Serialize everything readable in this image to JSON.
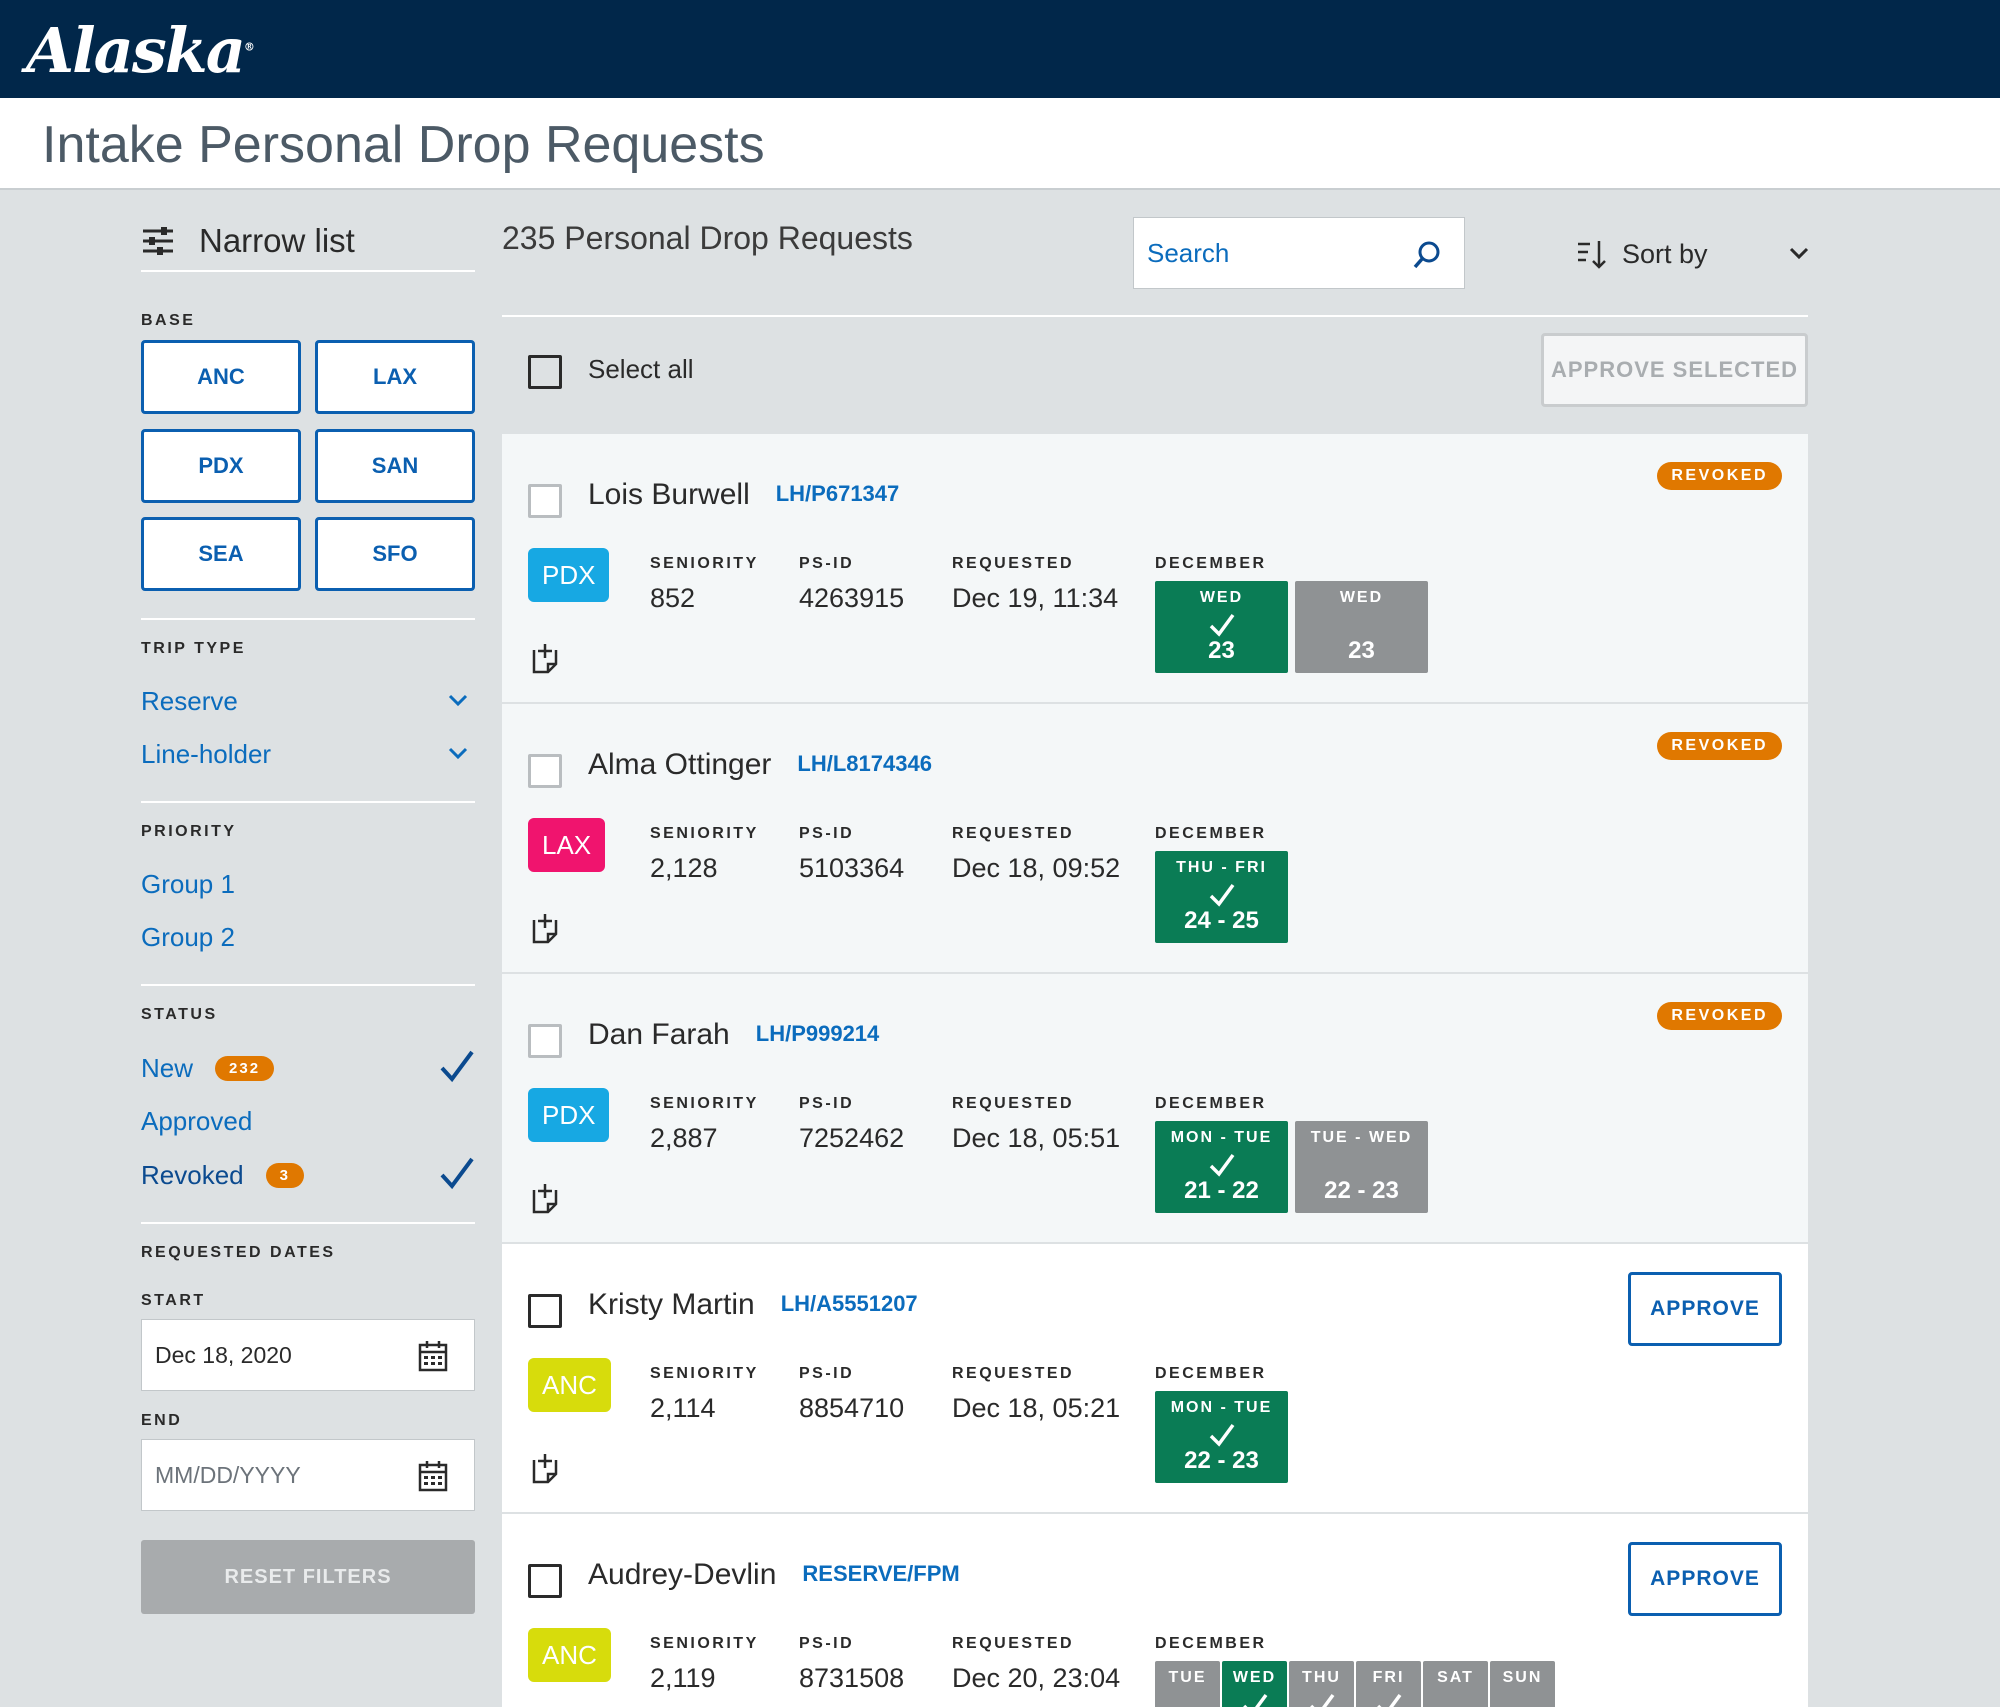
{
  "brand": {
    "logo_text": "Alaska"
  },
  "page": {
    "title": "Intake Personal Drop Requests"
  },
  "sidebar": {
    "narrow_label": "Narrow list",
    "base_label": "BASE",
    "bases": [
      "ANC",
      "LAX",
      "PDX",
      "SAN",
      "SEA",
      "SFO"
    ],
    "trip_type_label": "TRIP TYPE",
    "trip_types": [
      "Reserve",
      "Line-holder"
    ],
    "priority_label": "PRIORITY",
    "priorities": [
      "Group 1",
      "Group 2"
    ],
    "status_label": "STATUS",
    "statuses": [
      {
        "label": "New",
        "count": "232",
        "checked": true
      },
      {
        "label": "Approved",
        "count": "",
        "checked": false
      },
      {
        "label": "Revoked",
        "count": "3",
        "checked": true
      }
    ],
    "requested_dates_label": "REQUESTED DATES",
    "start_label": "START",
    "start_value": "Dec 18, 2020",
    "end_label": "END",
    "end_placeholder": "MM/DD/YYYY",
    "reset_label": "RESET FILTERS"
  },
  "main": {
    "heading": "235 Personal Drop Requests",
    "search_placeholder": "Search",
    "sort_label": "Sort by",
    "select_all_label": "Select all",
    "approve_selected_label": "APPROVE SELECTED",
    "field_labels": {
      "seniority": "SENIORITY",
      "psid": "PS-ID",
      "requested": "REQUESTED",
      "month": "DECEMBER"
    },
    "revoked_badge": "REVOKED",
    "approve_label": "APPROVE",
    "requests": [
      {
        "name": "Lois Burwell",
        "code": "LH/P671347",
        "base": "PDX",
        "seniority": "852",
        "psid": "4263915",
        "requested": "Dec 19, 11:34",
        "status": "revoked",
        "days": [
          {
            "day": "WED",
            "dates": "23",
            "color": "green",
            "checked": true
          },
          {
            "day": "WED",
            "dates": "23",
            "color": "gray",
            "checked": false
          }
        ]
      },
      {
        "name": "Alma Ottinger",
        "code": "LH/L8174346",
        "base": "LAX",
        "seniority": "2,128",
        "psid": "5103364",
        "requested": "Dec 18, 09:52",
        "status": "revoked",
        "days": [
          {
            "day": "THU - FRI",
            "dates": "24 - 25",
            "color": "green",
            "checked": true
          }
        ]
      },
      {
        "name": "Dan Farah",
        "code": "LH/P999214",
        "base": "PDX",
        "seniority": "2,887",
        "psid": "7252462",
        "requested": "Dec 18, 05:51",
        "status": "revoked",
        "days": [
          {
            "day": "MON - TUE",
            "dates": "21 - 22",
            "color": "green",
            "checked": true
          },
          {
            "day": "TUE - WED",
            "dates": "22 - 23",
            "color": "gray",
            "checked": false
          }
        ]
      },
      {
        "name": "Kristy Martin",
        "code": "LH/A5551207",
        "base": "ANC",
        "seniority": "2,114",
        "psid": "8854710",
        "requested": "Dec 18, 05:21",
        "status": "new",
        "days": [
          {
            "day": "MON - TUE",
            "dates": "22 - 23",
            "color": "green",
            "checked": true
          }
        ]
      },
      {
        "name": "Audrey-Devlin",
        "code": "RESERVE/FPM",
        "base": "ANC",
        "seniority": "2,119",
        "psid": "8731508",
        "requested": "Dec 20, 23:04",
        "status": "new",
        "days": [
          {
            "day": "TUE",
            "color": "gray",
            "checked": false
          },
          {
            "day": "WED",
            "color": "green",
            "checked": true
          },
          {
            "day": "THU",
            "color": "gray",
            "checked": true
          },
          {
            "day": "FRI",
            "color": "gray",
            "checked": true
          },
          {
            "day": "SAT",
            "color": "gray",
            "checked": false
          },
          {
            "day": "SUN",
            "color": "gray",
            "checked": false
          }
        ]
      }
    ]
  },
  "colors": {
    "navy": "#01274a",
    "link": "#0b6cbd",
    "green": "#0a7c55",
    "orange": "#e07800",
    "base_PDX": "#17a8e3",
    "base_LAX": "#f0146e",
    "base_ANC": "#d7dc0c"
  }
}
